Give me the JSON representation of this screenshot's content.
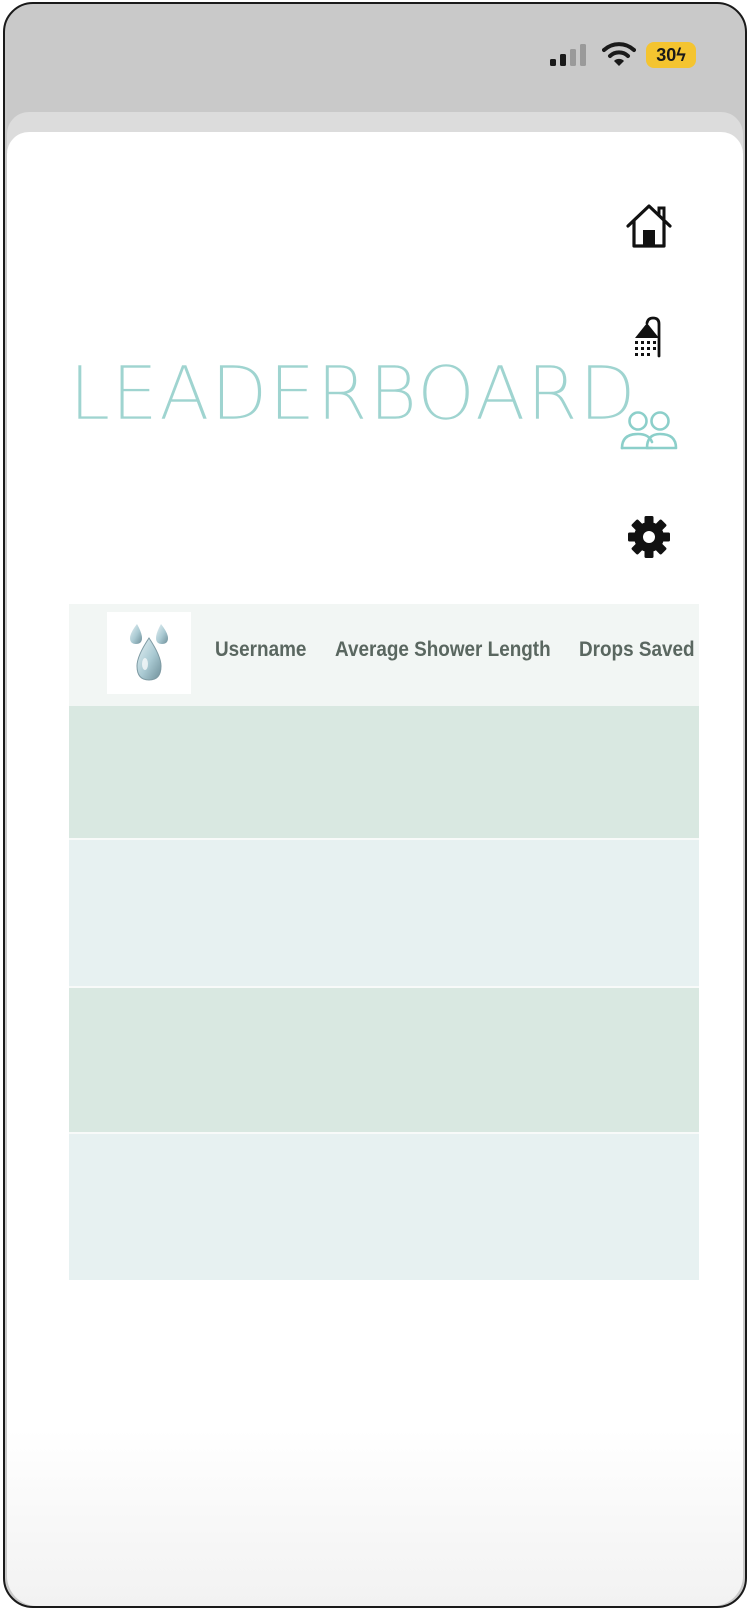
{
  "status_bar": {
    "battery_level": "30",
    "signal_icon": "cellular-signal-icon",
    "wifi_icon": "wifi-icon",
    "charging_icon": "bolt-icon"
  },
  "page": {
    "title": "LEADERBOARD"
  },
  "nav": {
    "items": [
      {
        "name": "home",
        "icon": "home-icon",
        "active": false
      },
      {
        "name": "shower",
        "icon": "shower-icon",
        "active": false
      },
      {
        "name": "leaderboard",
        "icon": "users-icon",
        "active": true
      },
      {
        "name": "settings",
        "icon": "gear-icon",
        "active": false
      }
    ]
  },
  "leaderboard_table": {
    "logo_icon": "water-drop-logo",
    "columns": [
      "Username",
      "Average Shower Length",
      "Drops Saved"
    ],
    "rows": [
      {
        "username": "",
        "average_shower_length": "",
        "drops_saved": ""
      },
      {
        "username": "",
        "average_shower_length": "",
        "drops_saved": ""
      },
      {
        "username": "",
        "average_shower_length": "",
        "drops_saved": ""
      },
      {
        "username": "",
        "average_shower_length": "",
        "drops_saved": ""
      }
    ]
  },
  "colors": {
    "accent": "#9fd4d0",
    "row_green": "#d9e8e1",
    "row_blue": "#e7f1f1",
    "header_bg": "#f2f6f4",
    "battery": "#f4c430"
  }
}
